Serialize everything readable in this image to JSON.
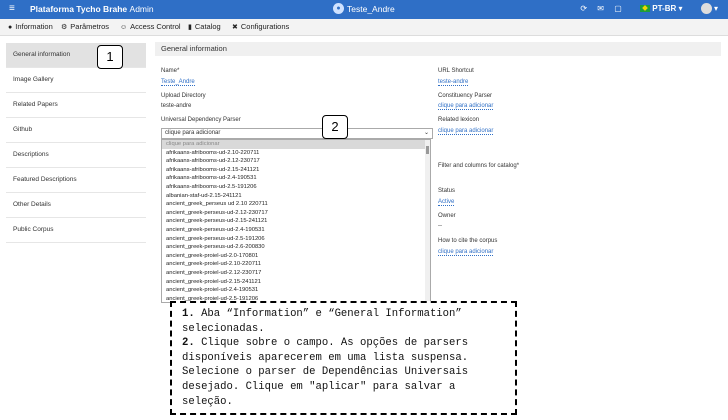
{
  "topbar": {
    "brand": "Plataforma Tycho Brahe",
    "brand_sub": "Admin",
    "center_title": "Teste_Andre",
    "lang": "PT-BR"
  },
  "tabs": [
    {
      "icon": "info-icon",
      "glyph": "●",
      "label": "Information"
    },
    {
      "icon": "gears-icon",
      "glyph": "⚙",
      "label": "Parâmetros"
    },
    {
      "icon": "users-icon",
      "glyph": "☺",
      "label": "Access Control"
    },
    {
      "icon": "book-icon",
      "glyph": "▮",
      "label": "Catalog"
    },
    {
      "icon": "wrench-icon",
      "glyph": "✖",
      "label": "Configurations"
    }
  ],
  "sidebar": {
    "items": [
      {
        "label": "General information"
      },
      {
        "label": "Image Gallery"
      },
      {
        "label": "Related Papers"
      },
      {
        "label": "Github"
      },
      {
        "label": "Descriptions"
      },
      {
        "label": "Featured Descriptions"
      },
      {
        "label": "Other Details"
      },
      {
        "label": "Public Corpus"
      }
    ]
  },
  "main": {
    "title": "General information",
    "left": {
      "name_label": "Name*",
      "name_value": "Teste_Andre",
      "upload_label": "Upload Directory",
      "upload_value": "teste-andre",
      "parser_label": "Universal Dependency Parser",
      "parser_selected": "clique para adicionar"
    },
    "right": {
      "url_label": "URL Shortcut",
      "url_value": "teste-andre",
      "constituency_label": "Constituency Parser",
      "constituency_value": "clique para adicionar",
      "lexicon_label": "Related lexicon",
      "lexicon_value": "clique para adicionar",
      "filter_label": "Filter and columns for catalog*",
      "status_label": "Status",
      "status_value": "Active",
      "owner_label": "Owner",
      "owner_value": "--",
      "cite_label": "How to cite the corpus",
      "cite_value": "clique para adicionar"
    }
  },
  "dropdown_options": [
    "clique para adicionar",
    "afrikaans-afribooms-ud-2.10-220711",
    "afrikaans-afribooms-ud-2.12-230717",
    "afrikaans-afribooms-ud-2.15-241121",
    "afrikaans-afribooms-ud-2.4-190531",
    "afrikaans-afribooms-ud-2.5-191206",
    "albanian-staf-ud-2.15-241121",
    "ancient_greek_perseus ud 2.10 220711",
    "ancient_greek-perseus-ud-2.12-230717",
    "ancient_greek-perseus-ud-2.15-241121",
    "ancient_greek-perseus-ud-2.4-190531",
    "ancient_greek-perseus-ud-2.5-191206",
    "ancient_greek-perseus-ud-2.6-200830",
    "ancient_greek-proiel-ud-2.0-170801",
    "ancient_greek-proiel-ud-2.10-220711",
    "ancient_greek-proiel-ud-2.12-230717",
    "ancient_greek-proiel-ud-2.15-241121",
    "ancient_greek-proiel-ud-2.4-190531",
    "ancient_greek-proiel-ud-2.5-191206"
  ],
  "callouts": {
    "one": "1",
    "two": "2"
  },
  "note": {
    "n1": "1.",
    "t1": " Aba “Information” e “General Information” selecionadas.",
    "n2": "2.",
    "t2": " Clique sobre o campo. As opções de parsers disponíveis aparecerem em uma lista suspensa. Selecione o parser de Dependências Universais desejado. Clique em \"aplicar\" para salvar a seleção."
  }
}
